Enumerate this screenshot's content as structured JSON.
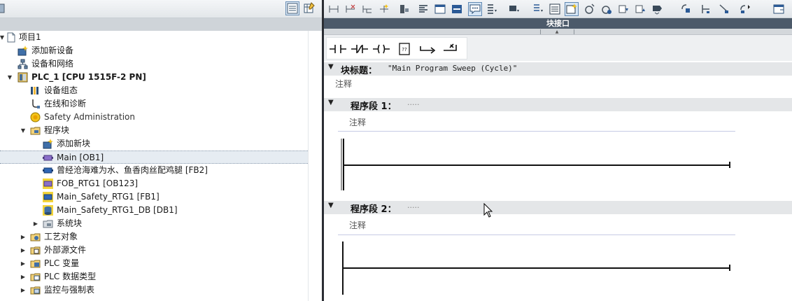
{
  "tree": {
    "items": [
      {
        "label": "项目1",
        "name": "tree-item-project",
        "bold": false
      },
      {
        "label": "添加新设备",
        "name": "tree-item-add-device",
        "bold": false
      },
      {
        "label": "设备和网络",
        "name": "tree-item-devices-networks",
        "bold": false
      },
      {
        "label": "PLC_1 [CPU 1515F-2 PN]",
        "name": "tree-item-plc1",
        "bold": true
      },
      {
        "label": "设备组态",
        "name": "tree-item-device-config",
        "bold": false
      },
      {
        "label": "在线和诊断",
        "name": "tree-item-online-diag",
        "bold": false
      },
      {
        "label": "Safety Administration",
        "name": "tree-item-safety-admin",
        "bold": false
      },
      {
        "label": "程序块",
        "name": "tree-item-program-blocks",
        "bold": false
      },
      {
        "label": "添加新块",
        "name": "tree-item-add-block",
        "bold": false
      },
      {
        "label": "Main [OB1]",
        "name": "tree-item-main-ob1",
        "bold": false
      },
      {
        "label": "曾经沧海难为水、鱼香肉丝配鸡腿 [FB2]",
        "name": "tree-item-fb2",
        "bold": false
      },
      {
        "label": "FOB_RTG1 [OB123]",
        "name": "tree-item-fob-rtg1",
        "bold": false
      },
      {
        "label": "Main_Safety_RTG1 [FB1]",
        "name": "tree-item-main-safety-fb1",
        "bold": false
      },
      {
        "label": "Main_Safety_RTG1_DB [DB1]",
        "name": "tree-item-main-safety-db1",
        "bold": false
      },
      {
        "label": "系统块",
        "name": "tree-item-system-blocks",
        "bold": false
      },
      {
        "label": "工艺对象",
        "name": "tree-item-tech-objects",
        "bold": false
      },
      {
        "label": "外部源文件",
        "name": "tree-item-external-sources",
        "bold": false
      },
      {
        "label": "PLC 变量",
        "name": "tree-item-plc-tags",
        "bold": false
      },
      {
        "label": "PLC 数据类型",
        "name": "tree-item-plc-datatypes",
        "bold": false
      },
      {
        "label": "监控与强制表",
        "name": "tree-item-watch-tables",
        "bold": false
      }
    ]
  },
  "editor": {
    "interface_label": "块接口",
    "block_title_label": "块标题：",
    "block_title_value": "\"Main Program Sweep (Cycle)\"",
    "block_comment": "注释",
    "networks": [
      {
        "label": "程序段 1：",
        "dots": ".....",
        "comment": "注释"
      },
      {
        "label": "程序段 2：",
        "dots": ".....",
        "comment": "注释"
      }
    ]
  },
  "colors": {
    "interface_bar": "#4c5a6a",
    "section_band": "#e4e6e8",
    "splitter": "#2a2d33"
  }
}
